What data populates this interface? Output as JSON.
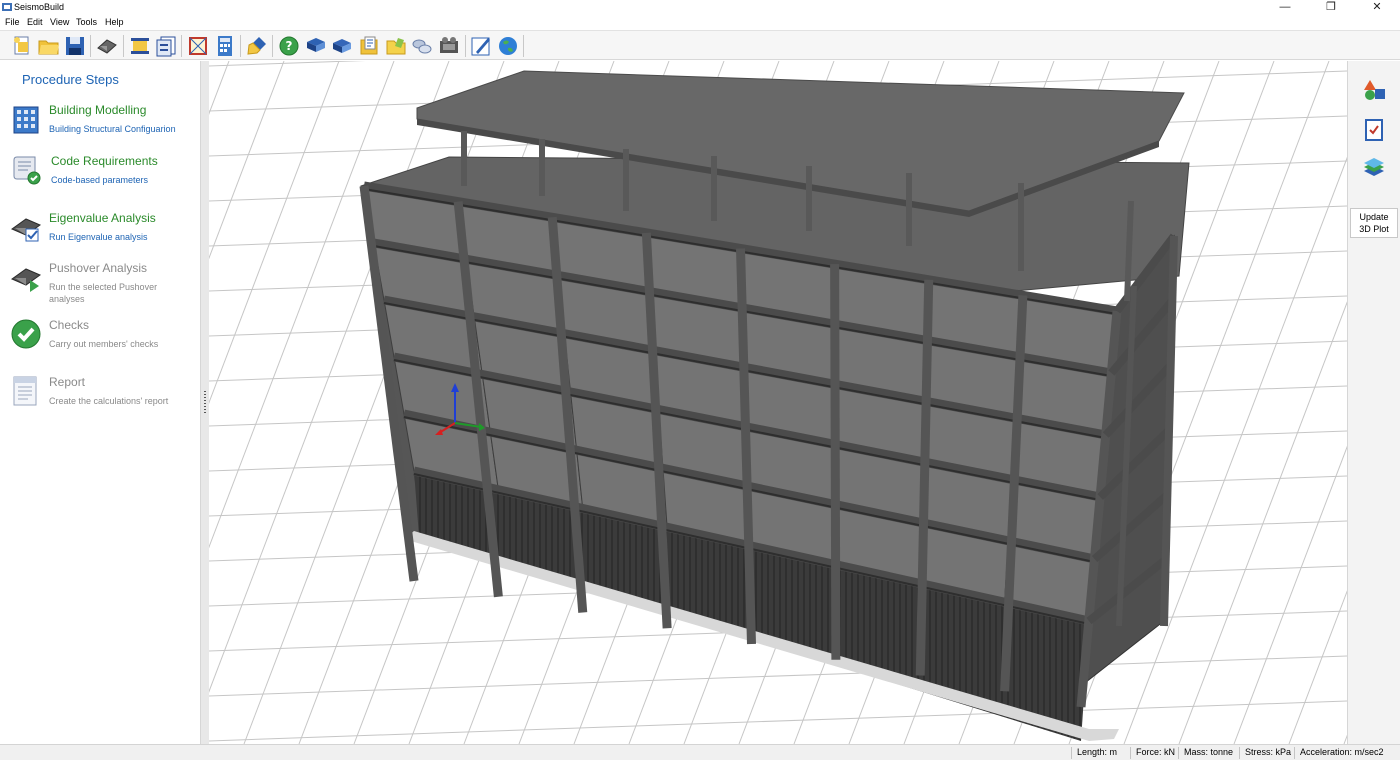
{
  "window": {
    "title": "SeismoBuild",
    "minimize": "—",
    "maximize": "❐",
    "close": "✕"
  },
  "menu": [
    "File",
    "Edit",
    "View",
    "Tools",
    "Help"
  ],
  "toolbar": {
    "buttons": [
      "new-project",
      "open-folder",
      "save",
      "building-model",
      "beam-section",
      "floor-plans",
      "frame-view",
      "calculator",
      "paint-brush",
      "help",
      "book",
      "book-2",
      "folder-notes",
      "folder-docs",
      "connections",
      "film",
      "edit-pen",
      "globe"
    ]
  },
  "procedure": {
    "title": "Procedure Steps",
    "steps": [
      {
        "title": "Building Modelling",
        "desc": "Building Structural Configuarion",
        "state": "active",
        "icon": "building-icon"
      },
      {
        "title": "Code Requirements",
        "desc": "Code-based parameters",
        "state": "active",
        "icon": "scroll-check-icon"
      },
      {
        "title": "Eigenvalue Analysis",
        "desc": "Run Eigenvalue analysis",
        "state": "active",
        "icon": "eigenvalue-icon"
      },
      {
        "title": "Pushover Analysis",
        "desc": "Run the selected Pushover analyses",
        "state": "disabled",
        "icon": "pushover-icon"
      },
      {
        "title": "Checks",
        "desc": "Carry out members' checks",
        "state": "disabled",
        "icon": "check-circle-icon"
      },
      {
        "title": "Report",
        "desc": "Create the calculations' report",
        "state": "disabled",
        "icon": "report-icon"
      }
    ]
  },
  "rightpanel": {
    "buttons": [
      "shapes-icon",
      "checklist-icon",
      "layers-icon"
    ],
    "update_line1": "Update",
    "update_line2": "3D Plot"
  },
  "status": {
    "length": "Length: m",
    "force": "Force: kN",
    "mass": "Mass: tonne",
    "stress": "Stress: kPa",
    "acceleration": "Acceleration: m/sec2"
  },
  "model": {
    "storeys": 6,
    "bays_front": 8,
    "bays_side": 4,
    "colors": {
      "concrete": "#6a6a6a",
      "slab": "#747474",
      "grid": "#c6c6c6"
    }
  }
}
